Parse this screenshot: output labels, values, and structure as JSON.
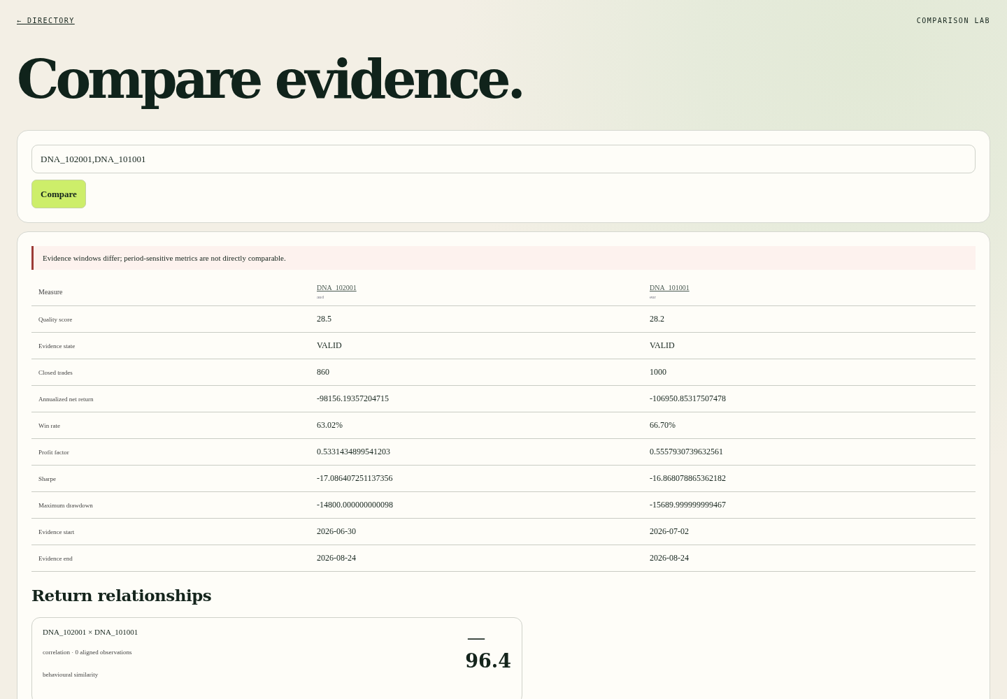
{
  "nav": {
    "back_link": "← DIRECTORY",
    "brand": "COMPARISON LAB"
  },
  "title": "Compare evidence.",
  "form": {
    "value": "DNA_102001,DNA_101001",
    "button": "Compare"
  },
  "warning": "Evidence windows differ; period-sensitive metrics are not directly comparable.",
  "table": {
    "measure_header": "Measure",
    "columns": [
      {
        "name": "DNA_102001",
        "currency": "aud"
      },
      {
        "name": "DNA_101001",
        "currency": "eur"
      }
    ],
    "rows": [
      {
        "measure": "Quality score",
        "values": [
          "28.5",
          "28.2"
        ]
      },
      {
        "measure": "Evidence state",
        "values": [
          "VALID",
          "VALID"
        ]
      },
      {
        "measure": "Closed trades",
        "values": [
          "860",
          "1000"
        ]
      },
      {
        "measure": "Annualized net return",
        "values": [
          "-98156.19357204715",
          "-106950.85317507478"
        ]
      },
      {
        "measure": "Win rate",
        "values": [
          "63.02%",
          "66.70%"
        ]
      },
      {
        "measure": "Profit factor",
        "values": [
          "0.5331434899541203",
          "0.5557930739632561"
        ]
      },
      {
        "measure": "Sharpe",
        "values": [
          "-17.086407251137356",
          "-16.868078865362182"
        ]
      },
      {
        "measure": "Maximum drawdown",
        "values": [
          "-14800.000000000098",
          "-15689.999999999467"
        ]
      },
      {
        "measure": "Evidence start",
        "values": [
          "2026-06-30",
          "2026-07-02"
        ]
      },
      {
        "measure": "Evidence end",
        "values": [
          "2026-08-24",
          "2026-08-24"
        ]
      }
    ]
  },
  "relationships": {
    "heading": "Return relationships",
    "cards": [
      {
        "pair": "DNA_102001 × DNA_101001",
        "detail": "correlation · 0 aligned observations",
        "label": "behavioural similarity",
        "value_top": "—",
        "value": "96.4"
      }
    ]
  }
}
